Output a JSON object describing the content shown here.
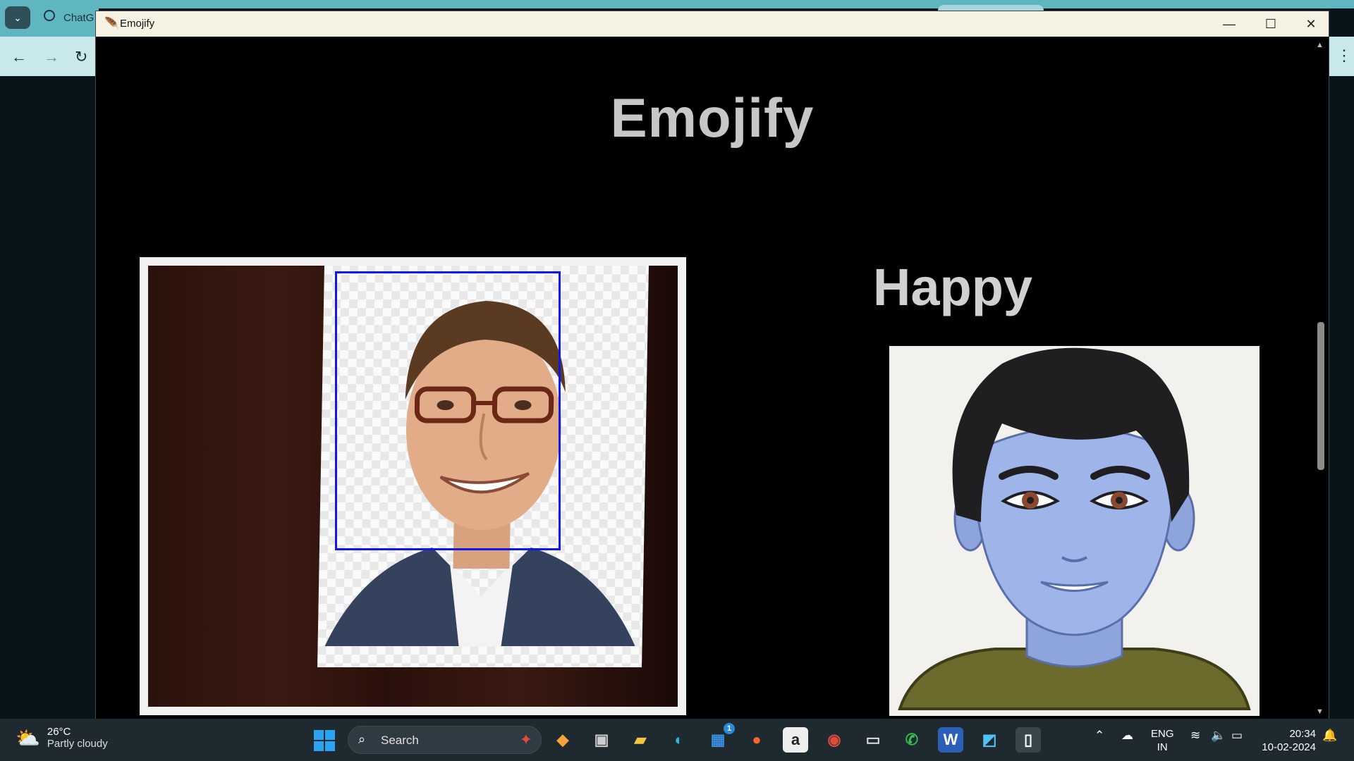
{
  "browser": {
    "tab_label": "ChatG",
    "back_icon": "arrow-left-icon",
    "forward_icon": "arrow-right-icon",
    "reload_icon": "reload-icon",
    "menu_icon": "kebab-menu-icon"
  },
  "window": {
    "title": "Emojify",
    "controls": [
      "minimize",
      "maximize",
      "close"
    ]
  },
  "app": {
    "heading": "Emojify",
    "emotion_label": "Happy"
  },
  "taskbar": {
    "weather_temp": "26°C",
    "weather_desc": "Partly cloudy",
    "search_placeholder": "Search",
    "store_badge": "1",
    "lang_line1": "ENG",
    "lang_line2": "IN",
    "time": "20:34",
    "date": "10-02-2024"
  },
  "colors": {
    "face_box": "#1018e8",
    "heading": "#c7c7c7",
    "taskbar": "#1f2a30"
  }
}
